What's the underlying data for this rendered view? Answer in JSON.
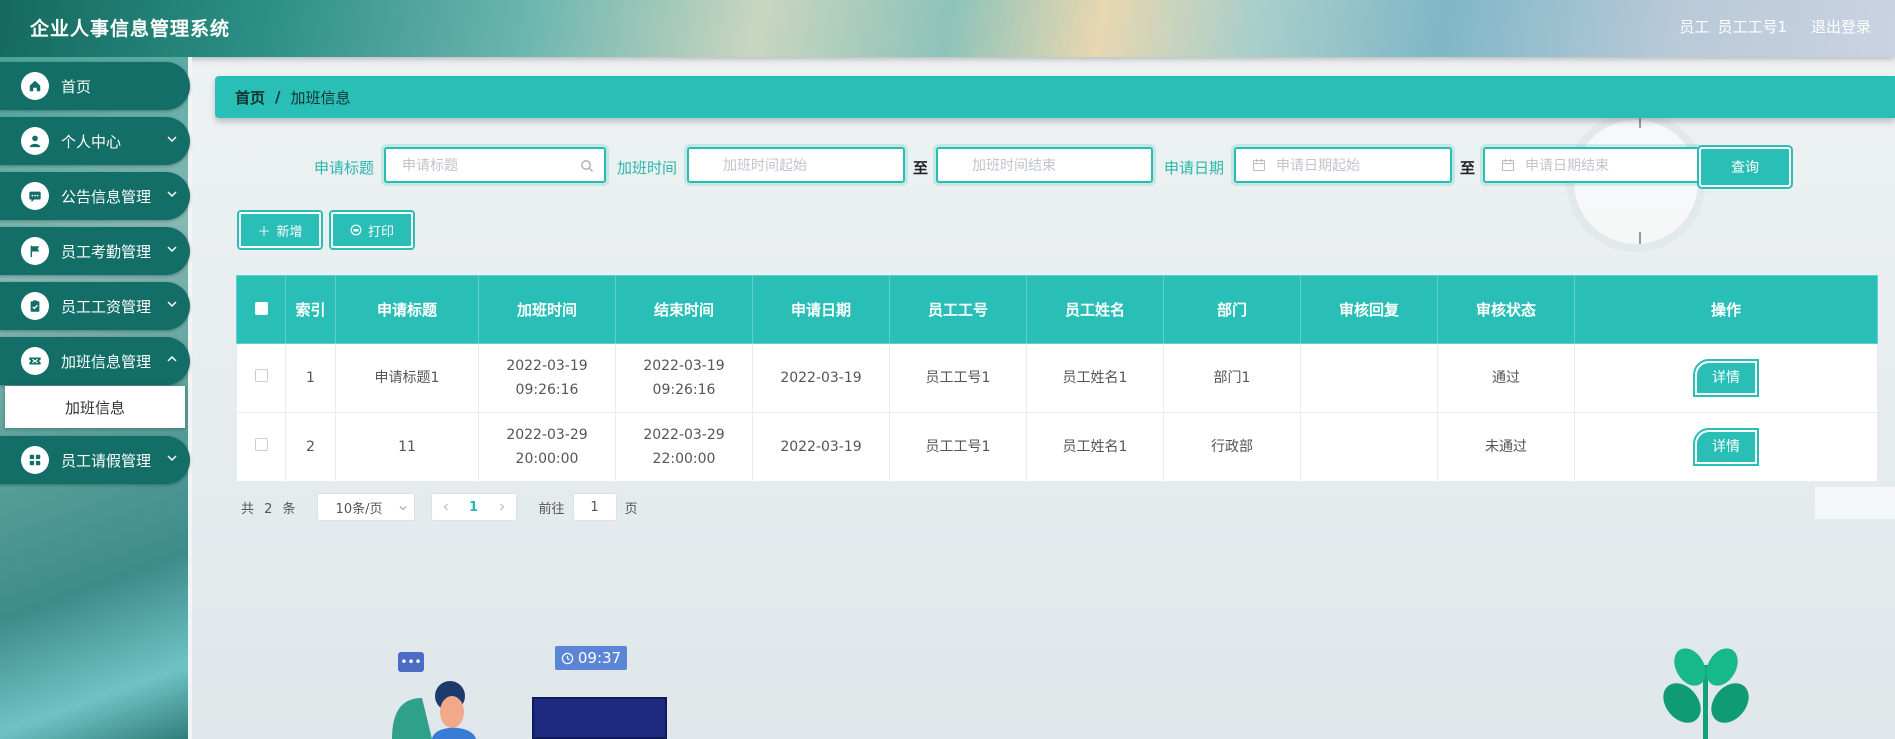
{
  "app": {
    "title": "企业人事信息管理系统"
  },
  "header": {
    "role": "员工",
    "username": "员工工号1",
    "logout": "退出登录"
  },
  "sidebar": {
    "items": [
      {
        "label": "首页",
        "icon": "home-icon",
        "has_arrow": false
      },
      {
        "label": "个人中心",
        "icon": "user-icon",
        "has_arrow": true
      },
      {
        "label": "公告信息管理",
        "icon": "message-icon",
        "has_arrow": true
      },
      {
        "label": "员工考勤管理",
        "icon": "flag-icon",
        "has_arrow": true
      },
      {
        "label": "员工工资管理",
        "icon": "clipboard-check-icon",
        "has_arrow": true
      },
      {
        "label": "加班信息管理",
        "icon": "ticket-icon",
        "has_arrow": true
      },
      {
        "label": "员工请假管理",
        "icon": "grid-icon",
        "has_arrow": true
      }
    ],
    "active_sub": "加班信息"
  },
  "breadcrumb": {
    "home": "首页",
    "separator": "/",
    "current": "加班信息"
  },
  "search": {
    "title_label": "申请标题",
    "title_placeholder": "申请标题",
    "ot_time_label": "加班时间",
    "ot_start_placeholder": "加班时间起始",
    "to1": "至",
    "ot_end_placeholder": "加班时间结束",
    "apply_date_label": "申请日期",
    "date_start_placeholder": "申请日期起始",
    "to2": "至",
    "date_end_placeholder": "申请日期结束",
    "query_label": "查询"
  },
  "actions": {
    "add_label": "新增",
    "print_label": "打印"
  },
  "table": {
    "columns": [
      "索引",
      "申请标题",
      "加班时间",
      "结束时间",
      "申请日期",
      "员工工号",
      "员工姓名",
      "部门",
      "审核回复",
      "审核状态",
      "操作"
    ],
    "rows": [
      {
        "index": "1",
        "title": "申请标题1",
        "ot_start": "2022-03-19 09:26:16",
        "ot_end": "2022-03-19 09:26:16",
        "apply_date": "2022-03-19",
        "emp_no": "员工工号1",
        "emp_name": "员工姓名1",
        "dept": "部门1",
        "reply": "",
        "status": "通过",
        "op": "详情"
      },
      {
        "index": "2",
        "title": "11",
        "ot_start": "2022-03-29 20:00:00",
        "ot_end": "2022-03-29 22:00:00",
        "apply_date": "2022-03-19",
        "emp_no": "员工工号1",
        "emp_name": "员工姓名1",
        "dept": "行政部",
        "reply": "",
        "status": "未通过",
        "op": "详情"
      }
    ]
  },
  "pagination": {
    "total_text": "共 2 条",
    "page_size": "10条/页",
    "current_page": "1",
    "goto_prefix": "前往",
    "goto_value": "1",
    "goto_suffix": "页"
  },
  "decor": {
    "clock_time": "09:37"
  },
  "colors": {
    "accent": "#29beb6",
    "sidebar_item": "#126e66"
  }
}
